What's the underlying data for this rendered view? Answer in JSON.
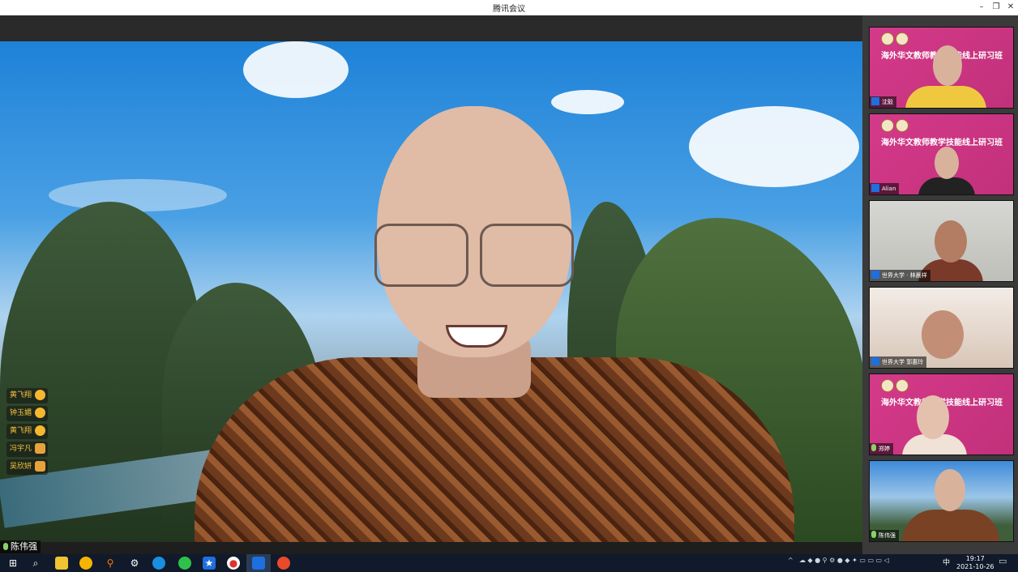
{
  "window": {
    "title": "腾讯会议"
  },
  "main": {
    "speaker_name": "陈伟强",
    "reactions": [
      {
        "name": "黄飞翔"
      },
      {
        "name": "钟玉媚"
      },
      {
        "name": "黄飞翔"
      },
      {
        "name": "冯宇凡"
      },
      {
        "name": "吴欣妍"
      }
    ]
  },
  "sidebar": {
    "banner_text": "海外华文教师教学技能线上研习班",
    "tiles": [
      {
        "label": "沈毅"
      },
      {
        "label": "Alian"
      },
      {
        "label": "世界大学 · 林晨祥"
      },
      {
        "label": "世界大学 郭惠玲"
      },
      {
        "label": "郑婷"
      },
      {
        "label": "陈伟强"
      }
    ]
  },
  "taskbar": {
    "time": "19:17",
    "date": "2021-10-26",
    "ime": "中"
  },
  "colors": {
    "accent_blue": "#1e6fe0",
    "banner_pink": "#d43a8a"
  }
}
